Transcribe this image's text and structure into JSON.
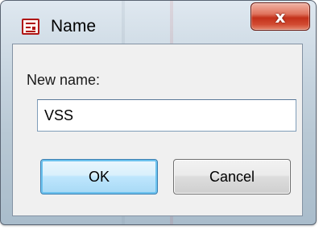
{
  "dialog": {
    "title": "Name",
    "close_glyph": "x",
    "prompt_label": "New name:",
    "name_value": "VSS",
    "ok_label": "OK",
    "cancel_label": "Cancel"
  },
  "icons": {
    "app": "dialog-app-icon",
    "close": "close-icon"
  },
  "colors": {
    "frame": "#c6d4df",
    "close_button": "#c3311a",
    "ok_button_border": "#3c7fb1",
    "client_background": "#f0f0f0"
  }
}
